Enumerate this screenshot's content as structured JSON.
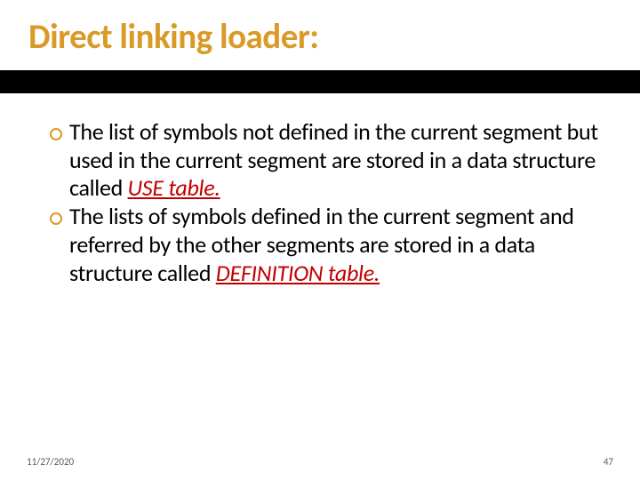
{
  "title": "Direct linking loader:",
  "bullets": [
    {
      "prefix": "The list of symbols not defined in the current segment but used in the current segment are stored in a data structure called ",
      "emph": "USE table."
    },
    {
      "prefix": "The lists of symbols defined in the current segment and referred by the other segments are stored in a data structure called ",
      "emph": "DEFINITION table."
    }
  ],
  "footer": {
    "date": "11/27/2020",
    "page": "47"
  }
}
